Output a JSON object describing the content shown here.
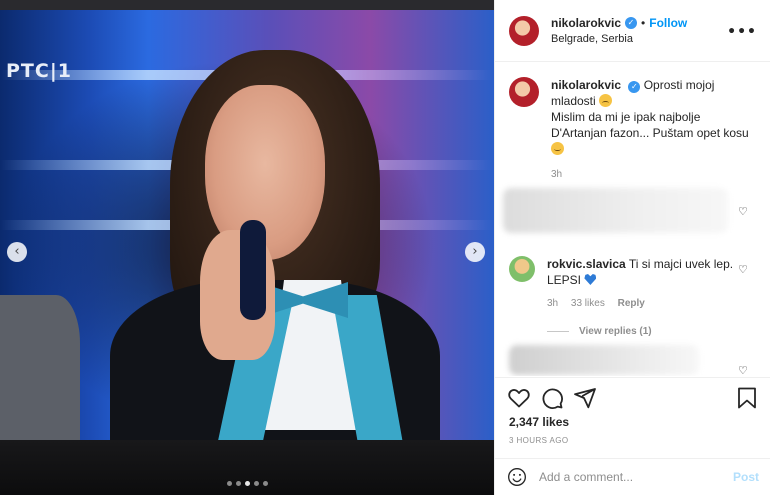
{
  "photo": {
    "tv_logo": "PTC|1",
    "prev_arrow": "‹",
    "next_arrow": "›",
    "carousel_dots": 5,
    "active_dot": 2
  },
  "header": {
    "username": "nikolarokvic",
    "verified": "✓",
    "separator": "•",
    "follow_label": "Follow",
    "location": "Belgrade, Serbia",
    "more_icon": "•••"
  },
  "caption": {
    "username": "nikolarokvic",
    "verified": "✓",
    "title_text": "Oprosti mojoj mladosti",
    "body_text": "Mislim da mi je ipak najbolje D'Artanjan fazon... Puštam opet kosu",
    "time": "3h"
  },
  "comment2": {
    "username": "rokvic.slavica",
    "text": "Ti si majci uvek lep. LEPSI",
    "time": "3h",
    "likes": "33 likes",
    "reply_label": "Reply",
    "view_replies": "View replies (1)"
  },
  "actions": {
    "likes": "2,347 likes",
    "timestamp": "3 HOURS AGO",
    "heart_icon": "heart-icon",
    "comment_icon": "comment-icon",
    "share_icon": "share-icon",
    "bookmark_icon": "bookmark-icon"
  },
  "add_comment": {
    "placeholder": "Add a comment...",
    "post_label": "Post"
  },
  "colors": {
    "accent": "#0095f6",
    "verified": "#3897f0",
    "muted": "#8e8e8e"
  },
  "small_heart": "♡"
}
